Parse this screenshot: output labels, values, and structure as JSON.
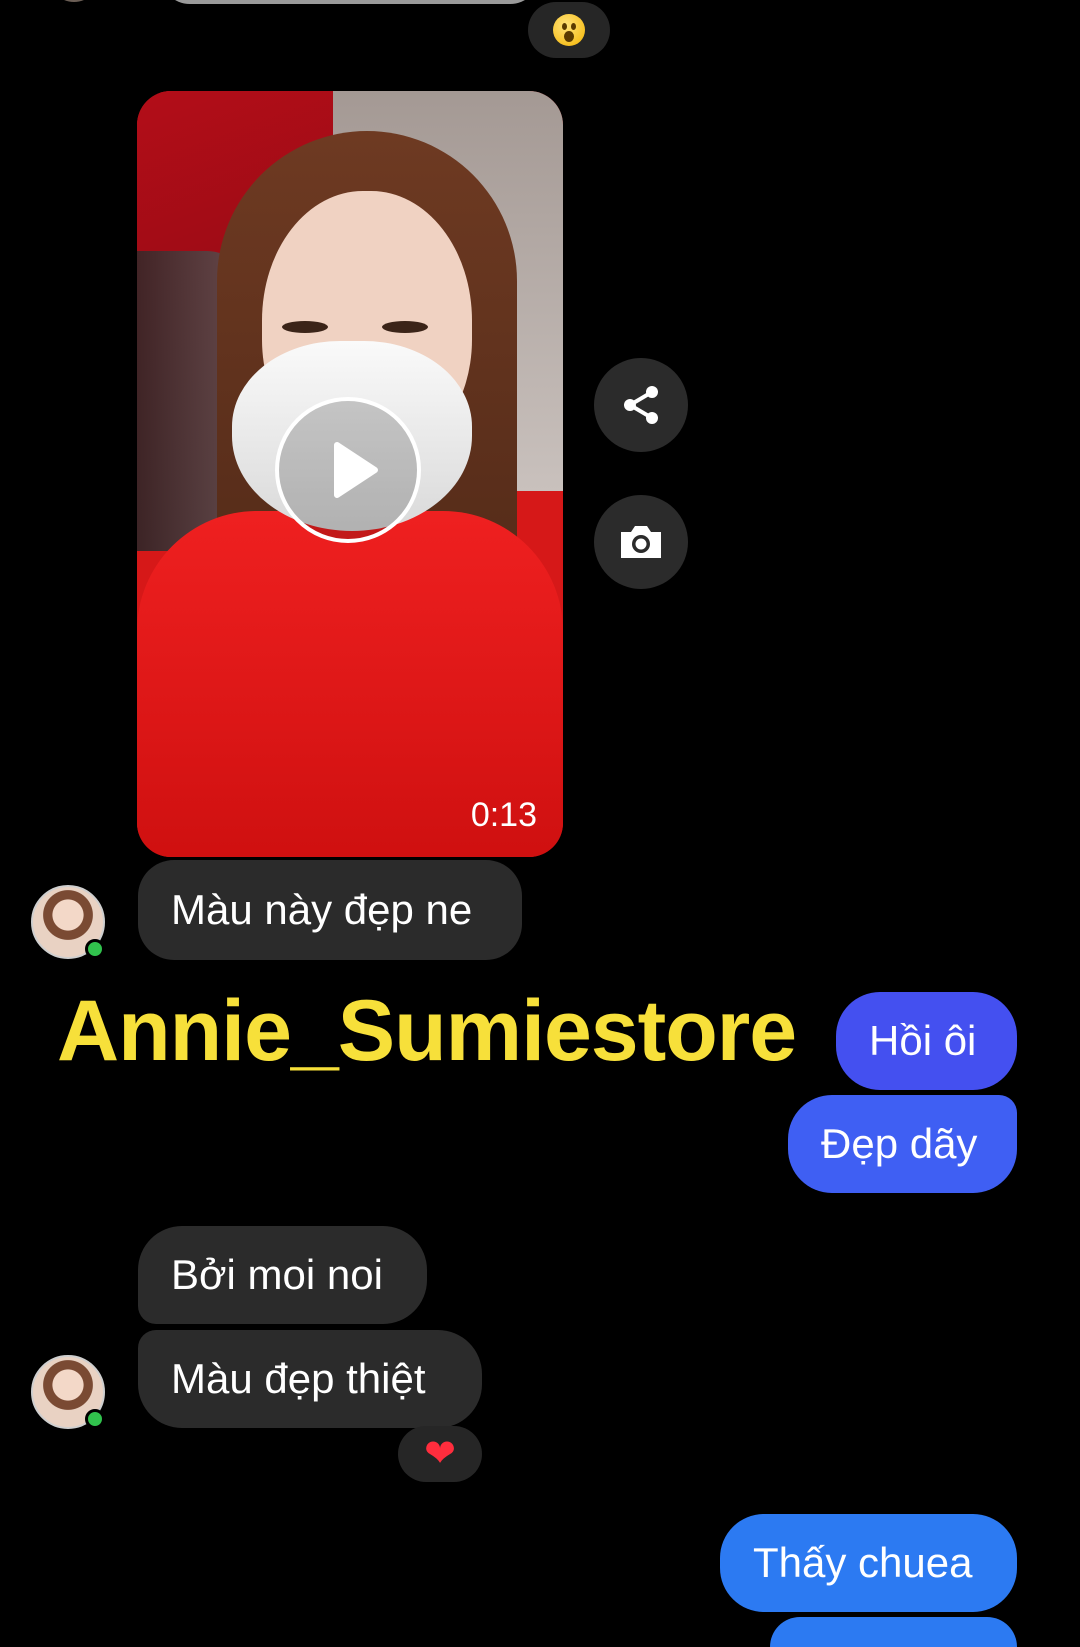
{
  "top": {
    "reaction": "😮"
  },
  "video": {
    "duration": "0:13"
  },
  "side_actions": {
    "share_icon": "share-icon",
    "camera_icon": "camera-icon"
  },
  "messages": [
    {
      "dir": "in",
      "text": "Màu này đẹp ne"
    },
    {
      "dir": "out",
      "text": "Hồi ôi"
    },
    {
      "dir": "out",
      "text": "Đẹp dãy"
    },
    {
      "dir": "in",
      "text": "Bởi moi noi"
    },
    {
      "dir": "in",
      "text": "Màu đẹp thiệt",
      "reaction": "❤"
    },
    {
      "dir": "out",
      "text": "Thấy chuea"
    }
  ],
  "watermark": "Annie_Sumiestore",
  "colors": {
    "background": "#000000",
    "incoming_bubble": "#2b2b2b",
    "outgoing_bubble": "#3a5cf5",
    "online_dot": "#31c24d",
    "watermark": "#f7e03a"
  }
}
